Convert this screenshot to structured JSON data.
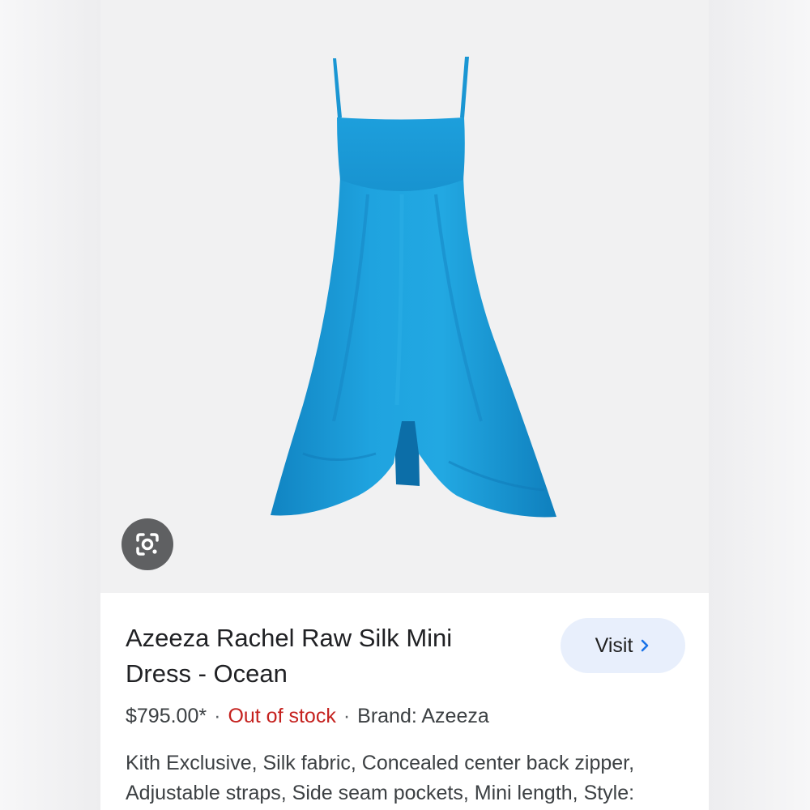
{
  "product": {
    "title": "Azeeza Rachel Raw Silk Mini Dress - Ocean",
    "price": "$795.00*",
    "separator": "·",
    "stock_status": "Out of stock",
    "brand": "Brand: Azeeza",
    "description": "Kith Exclusive, Silk fabric, Concealed center back zipper, Adjustable straps, Side seam pockets, Mini length, Style:"
  },
  "actions": {
    "visit_label": "Visit",
    "visit_icon": "chevron-right-icon",
    "lens_icon": "google-lens-icon"
  },
  "colors": {
    "dress": "#1a9ad6",
    "stock_status": "#c5221f",
    "visit_button_bg": "#e8effc",
    "visit_chevron": "#1a73e8",
    "lens_button_bg": "#5f6062"
  }
}
